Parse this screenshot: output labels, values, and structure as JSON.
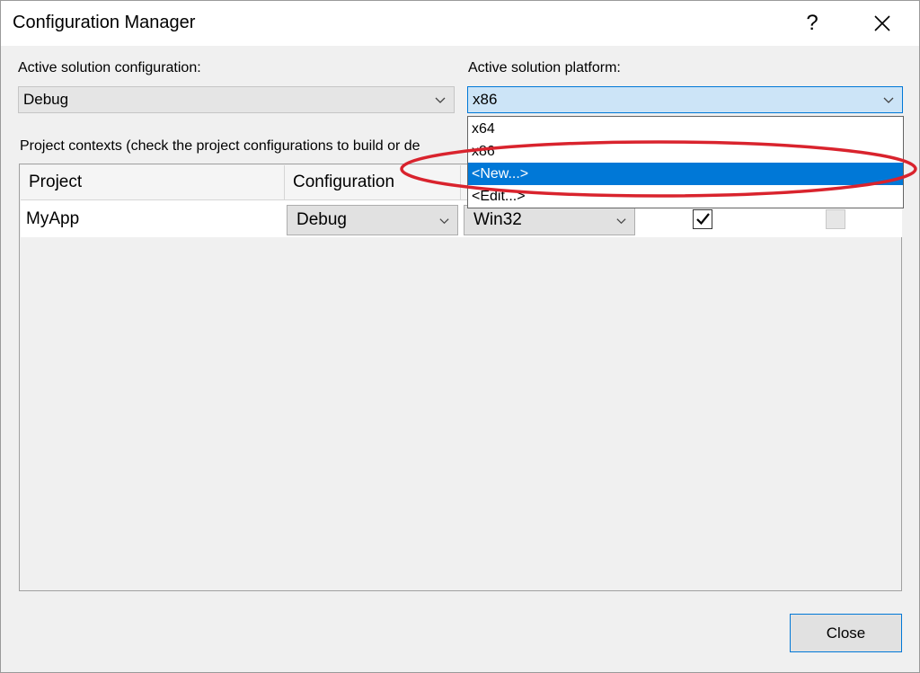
{
  "window": {
    "title": "Configuration Manager",
    "help_glyph": "?"
  },
  "solution": {
    "config_label": "Active solution configuration:",
    "config_value": "Debug",
    "platform_label": "Active solution platform:",
    "platform_value": "x86"
  },
  "platform_dropdown": {
    "options": [
      "x64",
      "x86",
      "<New...>",
      "<Edit...>"
    ],
    "highlighted": "<New...>"
  },
  "contexts": {
    "label": "Project contexts (check the project configurations to build or de",
    "columns": [
      "Project",
      "Configuration"
    ],
    "rows": [
      {
        "project": "MyApp",
        "configuration": "Debug",
        "platform": "Win32",
        "build_checked": true,
        "deploy_checked": false
      }
    ]
  },
  "footer": {
    "close_label": "Close"
  },
  "icons": {
    "close": "close-icon",
    "chevron": "chevron-down-icon",
    "check": "check-icon"
  },
  "colors": {
    "accent": "#0078d7",
    "dialog_bg": "#f0f0f0",
    "annotation": "#d9232d",
    "platform_focus_bg": "#cce4f7"
  }
}
